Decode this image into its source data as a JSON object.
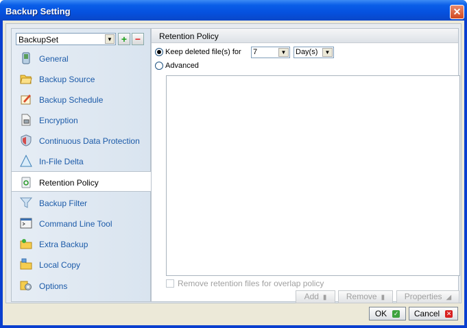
{
  "window": {
    "title": "Backup Setting",
    "close_glyph": "✕"
  },
  "sidebar": {
    "backup_set": {
      "value": "BackupSet"
    },
    "add_glyph": "+",
    "remove_glyph": "−",
    "selected_item": "Retention Policy",
    "items": [
      {
        "label": "General",
        "icon": "device-icon"
      },
      {
        "label": "Backup Source",
        "icon": "folder-open-icon"
      },
      {
        "label": "Backup Schedule",
        "icon": "schedule-icon"
      },
      {
        "label": "Encryption",
        "icon": "lock-document-icon"
      },
      {
        "label": "Continuous Data Protection",
        "icon": "shield-icon"
      },
      {
        "label": "In-File Delta",
        "icon": "delta-icon"
      },
      {
        "label": "Retention Policy",
        "icon": "recycle-icon"
      },
      {
        "label": "Backup Filter",
        "icon": "filter-icon"
      },
      {
        "label": "Command Line Tool",
        "icon": "terminal-icon"
      },
      {
        "label": "Extra Backup",
        "icon": "folder-star-icon"
      },
      {
        "label": "Local Copy",
        "icon": "folder-copy-icon"
      },
      {
        "label": "Options",
        "icon": "gears-icon"
      }
    ]
  },
  "panel": {
    "header": "Retention Policy",
    "keep_label": "Keep deleted file(s) for",
    "keep_value": "7",
    "unit_value": "Day(s)",
    "advanced_label": "Advanced",
    "overlap_label": "Remove retention files for overlap policy",
    "add_label": "Add",
    "remove_label": "Remove",
    "properties_label": "Properties"
  },
  "footer": {
    "ok_label": "OK",
    "cancel_label": "Cancel"
  },
  "colors": {
    "titlebar": "#0551df",
    "nav_text": "#1b5aa8",
    "ok_icon": "#3da33d",
    "cancel_icon": "#d82020"
  }
}
